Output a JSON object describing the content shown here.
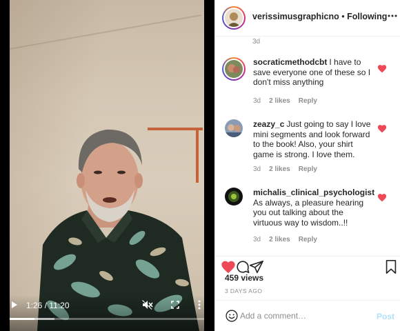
{
  "video": {
    "time_readout": "1:26 / 11:20",
    "progress_fraction": 0.1265,
    "buffered_fraction": 0.23,
    "play_icon": "play-icon",
    "mute_icon": "muted-speaker-icon",
    "fullscreen_icon": "fullscreen-icon",
    "more_icon": "vertical-dots-icon"
  },
  "header": {
    "username": "verissimusgraphicno",
    "separator": "•",
    "follow_status": "Following",
    "more_icon": "horizontal-dots-icon"
  },
  "comments_top_age": "3d",
  "comments": [
    {
      "username": "socraticmethodcbt",
      "text": "I have to save everyone one of these so I don't miss anything",
      "age": "3d",
      "likes": "2 likes",
      "reply": "Reply",
      "liked": true
    },
    {
      "username": "zeazy_c",
      "text": "Just going to say I love mini segments and look forward to the book! Also, your shirt game is strong. I love them.",
      "age": "3d",
      "likes": "2 likes",
      "reply": "Reply",
      "liked": true
    },
    {
      "username": "michalis_clinical_psychologist",
      "text": "As always, a pleasure hearing you out talking about the virtuous way to wisdom..!!",
      "age": "3d",
      "likes": "2 likes",
      "reply": "Reply",
      "liked": true
    }
  ],
  "actions": {
    "views": "459 views",
    "posted_ago": "3 DAYS AGO",
    "like_icon": "heart-filled-icon",
    "comment_icon": "comment-bubble-icon",
    "share_icon": "paper-plane-icon",
    "save_icon": "bookmark-icon"
  },
  "add_comment": {
    "placeholder": "Add a comment…",
    "post_label": "Post",
    "emoji_icon": "smiley-icon"
  },
  "colors": {
    "heart": "#ed4956",
    "post_disabled": "#b2dffc",
    "meta_gray": "#8e8e8e",
    "text": "#262626"
  }
}
